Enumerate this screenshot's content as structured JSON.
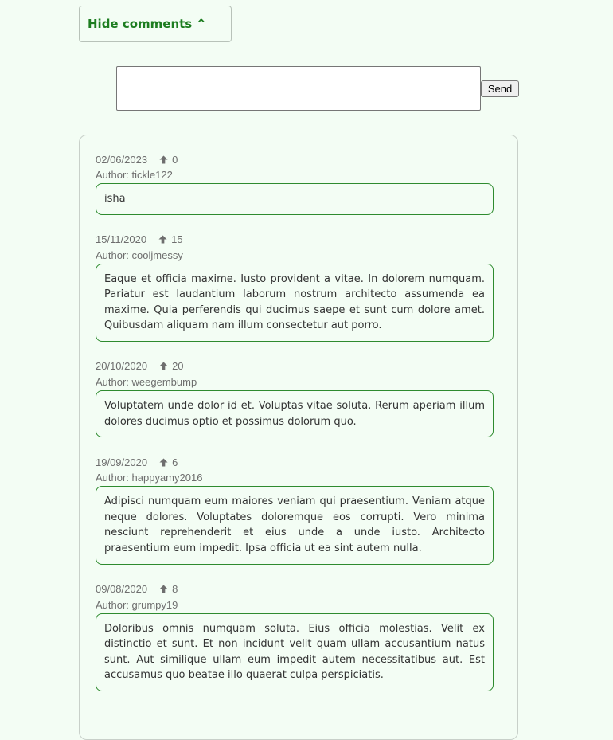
{
  "toggle": {
    "label": "Hide comments ^"
  },
  "composer": {
    "value": "",
    "send_label": "Send"
  },
  "comments": [
    {
      "date": "02/06/2023",
      "votes": "0",
      "author": "Author: tickle122",
      "body": "isha"
    },
    {
      "date": "15/11/2020",
      "votes": "15",
      "author": "Author: cooljmessy",
      "body": "Eaque et officia maxime. Iusto provident a vitae. In dolorem numquam. Pariatur est laudantium laborum nostrum architecto assumenda ea maxime. Quia perferendis qui ducimus saepe et sunt cum dolore amet. Quibusdam aliquam nam illum consectetur aut porro."
    },
    {
      "date": "20/10/2020",
      "votes": "20",
      "author": "Author: weegembump",
      "body": "Voluptatem unde dolor id et. Voluptas vitae soluta. Rerum aperiam illum dolores ducimus optio et possimus dolorum quo."
    },
    {
      "date": "19/09/2020",
      "votes": "6",
      "author": "Author: happyamy2016",
      "body": "Adipisci numquam eum maiores veniam qui praesentium. Veniam atque neque dolores. Voluptates doloremque eos corrupti. Vero minima nesciunt reprehenderit et eius unde a unde iusto. Architecto praesentium eum impedit. Ipsa officia ut ea sint autem nulla."
    },
    {
      "date": "09/08/2020",
      "votes": "8",
      "author": "Author: grumpy19",
      "body": "Doloribus omnis numquam soluta. Eius officia molestias. Velit ex distinctio et sunt. Et non incidunt velit quam ullam accusantium natus sunt. Aut similique ullam eum impedit autem necessitatibus aut. Est accusamus quo beatae illo quaerat culpa perspiciatis."
    }
  ],
  "icons": {
    "vote": "upvote-arrow-icon"
  },
  "colors": {
    "background": "#f3fdf4",
    "accent": "#1d7d20",
    "comment_border": "#2e8b2f",
    "meta_text": "#6e6e6e"
  }
}
